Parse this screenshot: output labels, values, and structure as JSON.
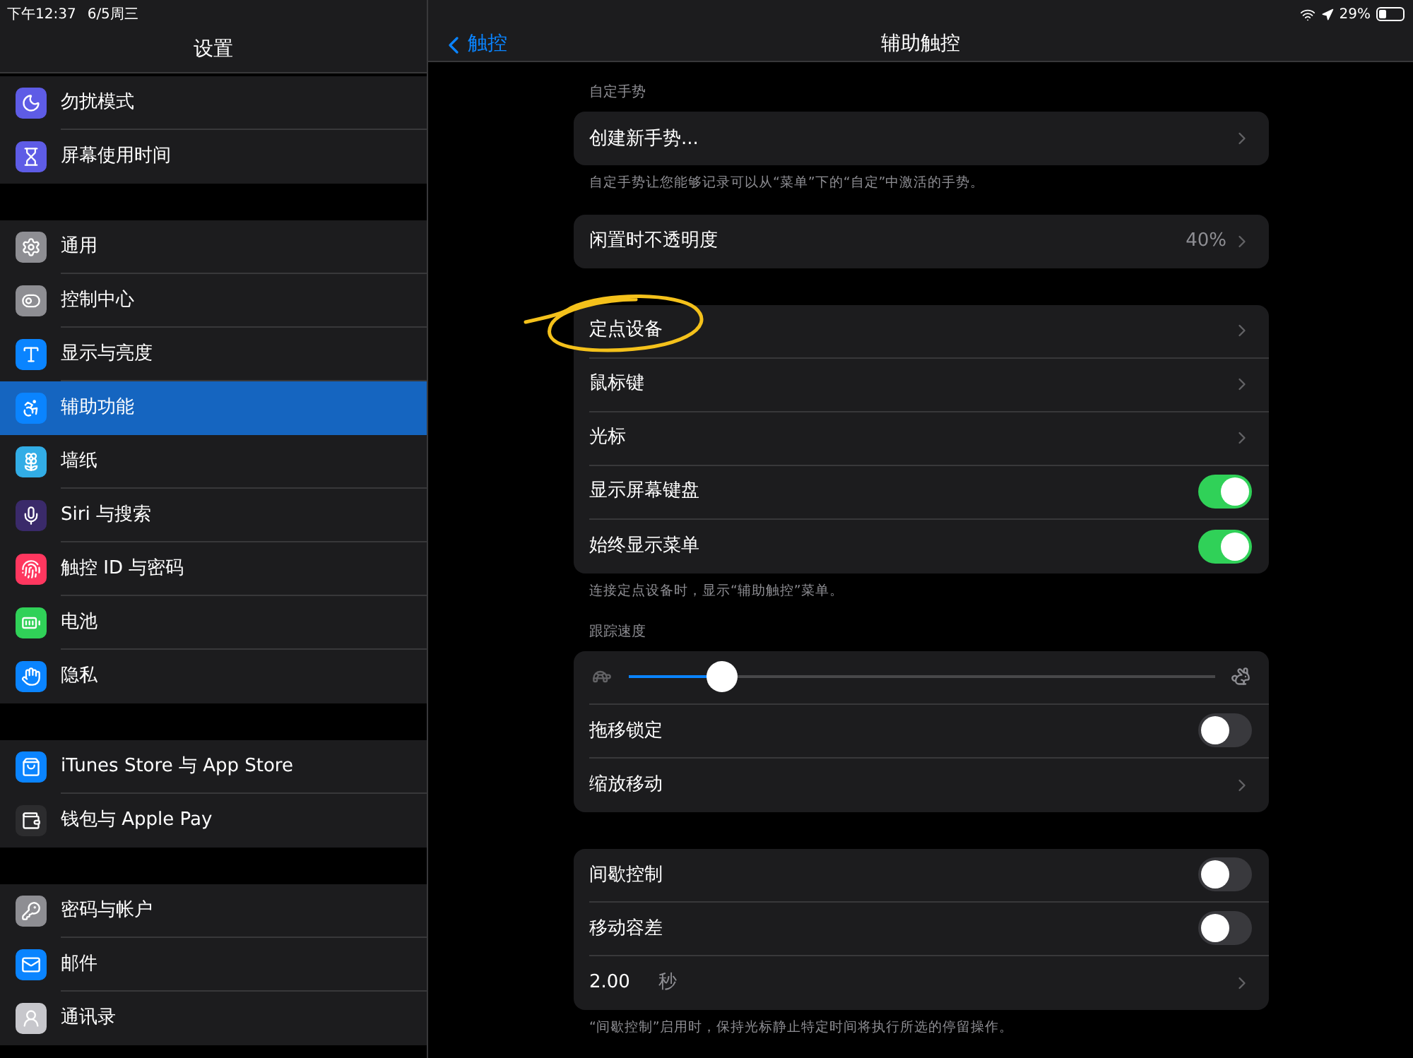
{
  "status_bar": {
    "time": "下午12:37",
    "date": "6/5周三",
    "battery": "29%"
  },
  "sidebar": {
    "title": "设置",
    "groups": [
      [
        {
          "label": "勿扰模式",
          "selected": false
        },
        {
          "label": "屏幕使用时间",
          "selected": false
        }
      ],
      [
        {
          "label": "通用",
          "selected": false
        },
        {
          "label": "控制中心",
          "selected": false
        },
        {
          "label": "显示与亮度",
          "selected": false
        },
        {
          "label": "辅助功能",
          "selected": true
        },
        {
          "label": "墙纸",
          "selected": false
        },
        {
          "label": "Siri 与搜索",
          "selected": false
        },
        {
          "label": "触控 ID 与密码",
          "selected": false
        },
        {
          "label": "电池",
          "selected": false
        },
        {
          "label": "隐私",
          "selected": false
        }
      ],
      [
        {
          "label": "iTunes Store 与 App Store",
          "selected": false
        },
        {
          "label": "钱包与 Apple Pay",
          "selected": false
        }
      ],
      [
        {
          "label": "密码与帐户",
          "selected": false
        },
        {
          "label": "邮件",
          "selected": false
        },
        {
          "label": "通讯录",
          "selected": false
        }
      ]
    ]
  },
  "detail": {
    "back": "触控",
    "title": "辅助触控",
    "sections": [
      {
        "header": "自定手势",
        "rows": [
          {
            "kind": "link",
            "label": "创建新手势..."
          }
        ],
        "footer": "自定手势让您能够记录可以从“菜单”下的“自定”中激活的手势。"
      },
      {
        "rows": [
          {
            "kind": "link",
            "label": "闲置时不透明度",
            "value": "40%"
          }
        ]
      },
      {
        "rows": [
          {
            "kind": "link",
            "label": "定点设备",
            "annotated": true
          },
          {
            "kind": "link",
            "label": "鼠标键"
          },
          {
            "kind": "link",
            "label": "光标"
          },
          {
            "kind": "toggle",
            "label": "显示屏幕键盘",
            "on": true
          },
          {
            "kind": "toggle",
            "label": "始终显示菜单",
            "on": true
          }
        ],
        "footer": "连接定点设备时，显示“辅助触控”菜单。"
      },
      {
        "header": "跟踪速度",
        "rows": [
          {
            "kind": "slider",
            "level": 0.16
          },
          {
            "kind": "toggle",
            "label": "拖移锁定",
            "on": false
          },
          {
            "kind": "link",
            "label": "缩放移动"
          }
        ]
      },
      {
        "rows": [
          {
            "kind": "toggle",
            "label": "间歇控制",
            "on": false
          },
          {
            "kind": "toggle",
            "label": "移动容差",
            "on": false
          },
          {
            "kind": "duration",
            "value": "2.00",
            "unit": "秒"
          }
        ],
        "footer": "“间歇控制”启用时，保持光标静止特定时间将执行所选的停留操作。"
      }
    ]
  }
}
